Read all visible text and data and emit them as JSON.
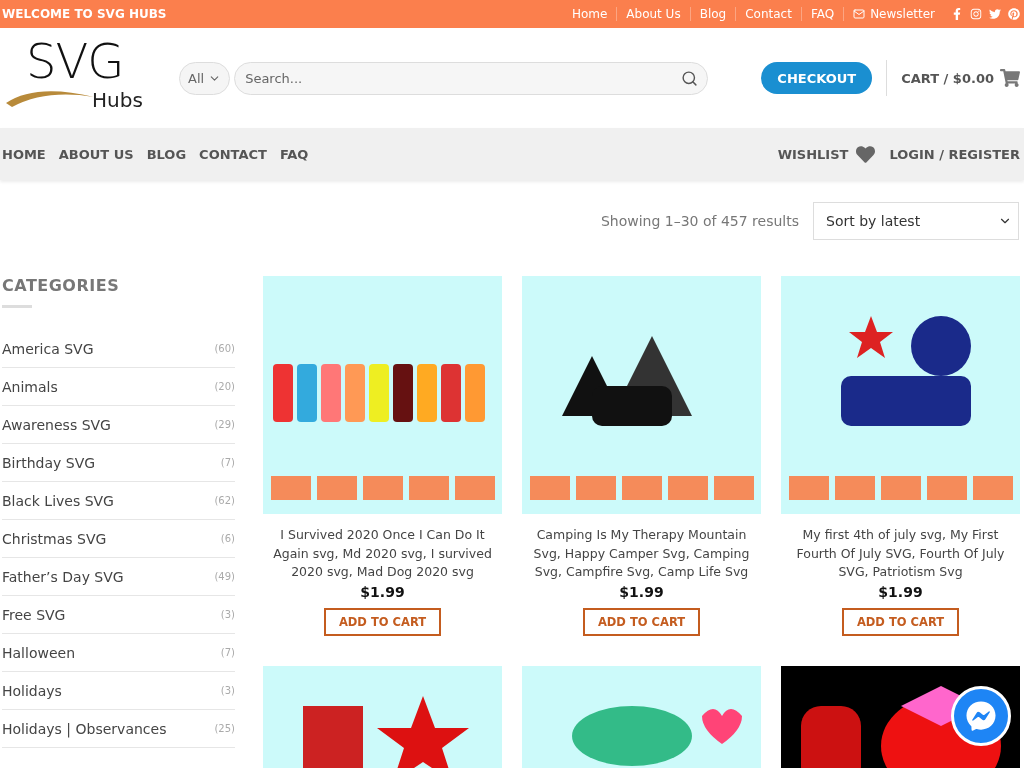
{
  "top_bar": {
    "welcome": "WELCOME TO SVG HUBS",
    "links": [
      "Home",
      "About Us",
      "Blog",
      "Contact",
      "FAQ"
    ],
    "newsletter": "Newsletter"
  },
  "logo": {
    "main": "SVG",
    "sub": "Hubs"
  },
  "search": {
    "category": "All",
    "placeholder": "Search..."
  },
  "checkout": "CHECKOUT",
  "cart": "CART / $0.00",
  "nav": {
    "items": [
      "HOME",
      "ABOUT US",
      "BLOG",
      "CONTACT",
      "FAQ"
    ],
    "wishlist": "WISHLIST",
    "login": "LOGIN / REGISTER"
  },
  "results": "Showing 1–30 of 457 results",
  "sort": "Sort by latest",
  "sidebar": {
    "title": "CATEGORIES",
    "items": [
      {
        "name": "America SVG",
        "count": "(60)"
      },
      {
        "name": "Animals",
        "count": "(20)"
      },
      {
        "name": "Awareness SVG",
        "count": "(29)"
      },
      {
        "name": "Birthday SVG",
        "count": "(7)"
      },
      {
        "name": "Black Lives SVG",
        "count": "(62)"
      },
      {
        "name": "Christmas SVG",
        "count": "(6)"
      },
      {
        "name": "Father’s Day SVG",
        "count": "(49)"
      },
      {
        "name": "Free SVG",
        "count": "(3)"
      },
      {
        "name": "Halloween",
        "count": "(7)"
      },
      {
        "name": "Holidays",
        "count": "(3)"
      },
      {
        "name": "Holidays | Observances",
        "count": "(25)"
      }
    ]
  },
  "products": [
    {
      "kind": "product",
      "title": "I Survived 2020 Once I Can Do It Again svg, Md 2020 svg, I survived 2020 svg, Mad Dog 2020 svg",
      "price": "$1.99",
      "button": "ADD TO CART"
    },
    {
      "kind": "product",
      "title": "Camping Is My Therapy Mountain Svg, Happy Camper Svg, Camping Svg, Campfire Svg, Camp Life Svg",
      "price": "$1.99",
      "button": "ADD TO CART"
    },
    {
      "kind": "product",
      "title": "My first 4th of july svg, My First Fourth Of July SVG, Fourth Of July SVG, Patriotism Svg",
      "price": "$1.99",
      "button": "ADD TO CART"
    },
    {
      "kind": "picture"
    },
    {
      "kind": "picture"
    },
    {
      "kind": "picture"
    }
  ]
}
